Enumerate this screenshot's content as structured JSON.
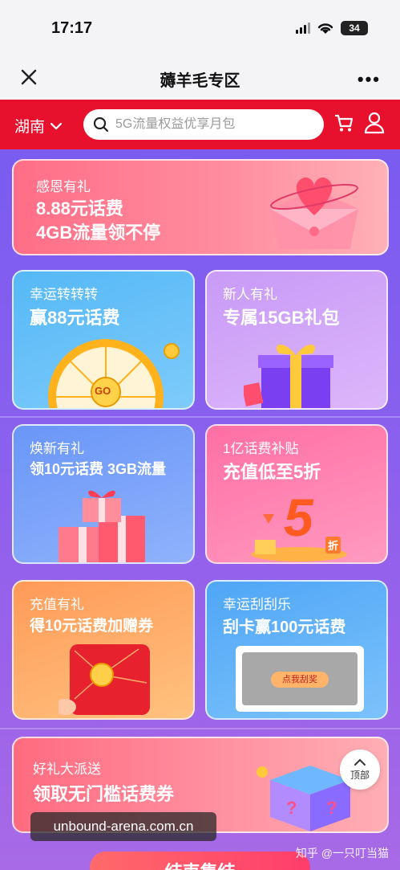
{
  "status_bar": {
    "time": "17:17",
    "battery": "34"
  },
  "nav": {
    "title": "薅羊毛专区"
  },
  "header": {
    "region": "湖南",
    "search_placeholder": "5G流量权益优享月包"
  },
  "cards": {
    "thanks": {
      "title": "感恩有礼",
      "line1": "8.88元话费",
      "line2": "4GB流量领不停"
    },
    "wheel": {
      "title": "幸运转转转",
      "line1": "赢88元话费",
      "go_label": "GO"
    },
    "newuser": {
      "title": "新人有礼",
      "line1": "专属15GB礼包"
    },
    "renew": {
      "title": "焕新有礼",
      "line1": "领10元话费 3GB流量"
    },
    "subsidy": {
      "title": "1亿话费补贴",
      "line1": "充值低至5折",
      "big_number": "5",
      "suffix": "折"
    },
    "recharge": {
      "title": "充值有礼",
      "line1": "得10元话费加赠券"
    },
    "scratch": {
      "title": "幸运刮刮乐",
      "line1": "刮卡赢100元话费",
      "scratch_button": "点我刮奖"
    },
    "gift": {
      "title": "好礼大派送",
      "line1": "领取无门槛话费券"
    }
  },
  "back_to_top": {
    "label": "顶部"
  },
  "watermark": "unbound-arena.com.cn",
  "credit": "知乎 @一只叮当猫",
  "bottom_button": "结束集结"
}
